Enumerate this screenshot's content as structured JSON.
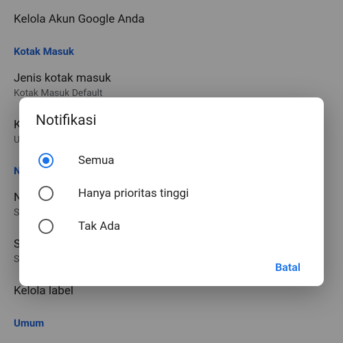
{
  "settings": {
    "manage_account": "Kelola Akun Google Anda",
    "inbox_header": "Kotak Masuk",
    "inbox_type_title": "Jenis kotak masuk",
    "inbox_type_sub": "Kotak Masuk Default",
    "categories_title": "K",
    "categories_sub": "U",
    "notif_header": "N",
    "notif_row_title": "N",
    "notif_row_sub": "Se",
    "sound_title": "Suara kotak masuk",
    "sound_sub": "Suara: nyala, berbunyi sekali",
    "manage_labels": "Kelola label",
    "general_header": "Umum"
  },
  "dialog": {
    "title": "Notifikasi",
    "options": [
      {
        "label": "Semua",
        "selected": true
      },
      {
        "label": "Hanya prioritas tinggi",
        "selected": false
      },
      {
        "label": "Tak Ada",
        "selected": false
      }
    ],
    "cancel": "Batal"
  }
}
